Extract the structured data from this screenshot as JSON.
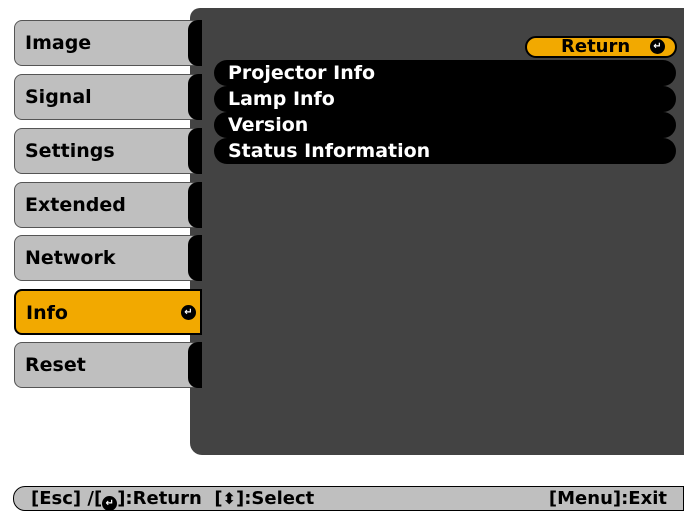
{
  "menu": {
    "tabs": [
      {
        "label": "Image"
      },
      {
        "label": "Signal"
      },
      {
        "label": "Settings"
      },
      {
        "label": "Extended"
      },
      {
        "label": "Network"
      },
      {
        "label": "Info",
        "selected": true,
        "icon": "enter-icon"
      },
      {
        "label": "Reset"
      }
    ]
  },
  "submenu": {
    "return_label": "Return",
    "items": [
      {
        "label": "Projector Info"
      },
      {
        "label": "Lamp Info"
      },
      {
        "label": "Version"
      },
      {
        "label": "Status Information"
      }
    ]
  },
  "footer": {
    "esc_prefix": "[Esc] /[",
    "return_text": "]:Return  [",
    "select_text": "]:Select",
    "exit_text": "[Menu]:Exit"
  },
  "colors": {
    "accent": "#f2a900",
    "panel": "#434343",
    "tab": "#bfbfbf"
  }
}
